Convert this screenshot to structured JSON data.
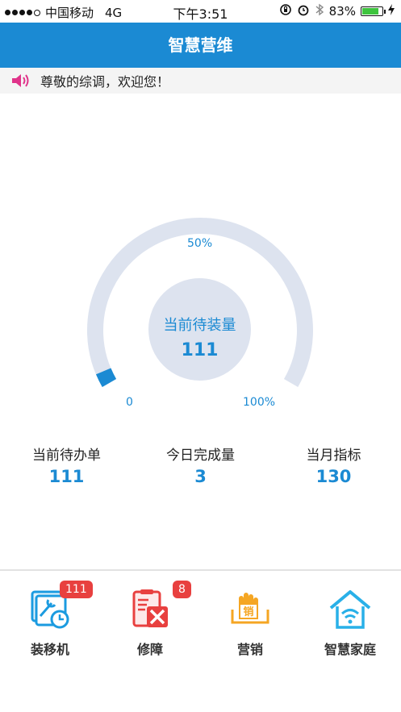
{
  "status": {
    "carrier": "中国移动",
    "network": "4G",
    "time": "下午3:51",
    "battery": "83%",
    "battery_level": 0.83
  },
  "header": {
    "title": "智慧营维"
  },
  "notice": {
    "text": "尊敬的综调，欢迎您！"
  },
  "gauge": {
    "min_label": "0",
    "mid_label": "50%",
    "max_label": "100%",
    "center_title": "当前待装量",
    "center_value": "111",
    "fill_fraction": 0.03
  },
  "stats": [
    {
      "label": "当前待办单",
      "value": "111"
    },
    {
      "label": "今日完成量",
      "value": "3"
    },
    {
      "label": "当月指标",
      "value": "130"
    }
  ],
  "nav": [
    {
      "label": "装移机",
      "badge": "111",
      "icon": "install-icon"
    },
    {
      "label": "修障",
      "badge": "8",
      "icon": "repair-icon"
    },
    {
      "label": "营销",
      "badge": "",
      "icon": "sales-icon"
    },
    {
      "label": "智慧家庭",
      "badge": "",
      "icon": "smart-home-icon"
    }
  ],
  "colors": {
    "brand": "#1b8ad3",
    "badge": "#e8403f",
    "gauge_track": "#dde3ef",
    "sales": "#f5a623",
    "repair": "#e8403f"
  }
}
